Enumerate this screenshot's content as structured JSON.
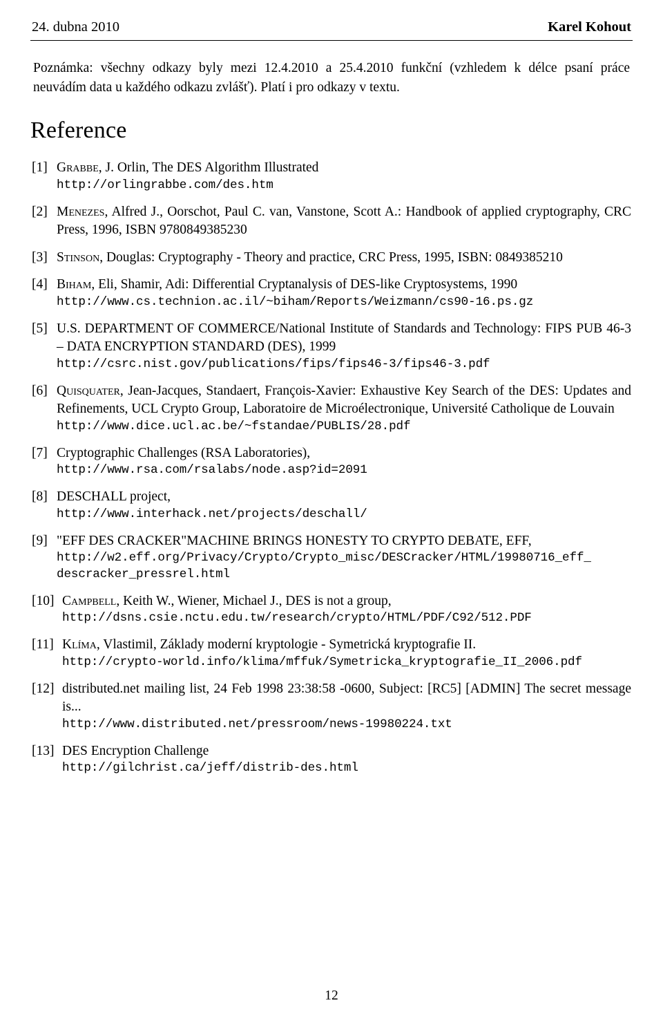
{
  "header": {
    "left": "24. dubna 2010",
    "right": "Karel Kohout"
  },
  "note": "Poznámka: všechny odkazy byly mezi 12.4.2010 a 25.4.2010 funkční (vzhledem k délce psaní práce neuvádím data u každého odkazu zvlášť). Platí i pro odkazy v textu.",
  "section_title": "Reference",
  "references": [
    {
      "label": "[1]",
      "author_sc": "Grabbe",
      "text": ", J. Orlin, The DES Algorithm Illustrated",
      "urls": [
        "http://orlingrabbe.com/des.htm"
      ]
    },
    {
      "label": "[2]",
      "author_sc": "Menezes",
      "text": ", Alfred J., Oorschot, Paul C. van, Vanstone, Scott A.: Handbook of applied cryptography, CRC Press, 1996, ISBN 9780849385230",
      "urls": []
    },
    {
      "label": "[3]",
      "author_sc": "Stinson",
      "text": ", Douglas: Cryptography - Theory and practice, CRC Press, 1995, ISBN: 0849385210",
      "urls": []
    },
    {
      "label": "[4]",
      "author_sc": "Biham",
      "text": ", Eli, Shamir, Adi: Differential Cryptanalysis of DES-like Cryptosystems, 1990",
      "urls": [
        "http://www.cs.technion.ac.il/~biham/Reports/Weizmann/cs90-16.ps.gz"
      ]
    },
    {
      "label": "[5]",
      "author_sc": "",
      "text": "U.S. DEPARTMENT OF COMMERCE/National Institute of Standards and Technology: FIPS PUB 46-3 – DATA ENCRYPTION STANDARD (DES), 1999",
      "urls": [
        "http://csrc.nist.gov/publications/fips/fips46-3/fips46-3.pdf"
      ]
    },
    {
      "label": "[6]",
      "author_sc": "Quisquater",
      "text": ", Jean-Jacques, Standaert, François-Xavier: Exhaustive Key Search of the DES: Updates and Refinements, UCL Crypto Group, Laboratoire de Microélectronique, Université Catholique de Louvain",
      "urls": [
        "http://www.dice.ucl.ac.be/~fstandae/PUBLIS/28.pdf"
      ]
    },
    {
      "label": "[7]",
      "author_sc": "",
      "text": "Cryptographic Challenges (RSA Laboratories),",
      "urls": [
        "http://www.rsa.com/rsalabs/node.asp?id=2091"
      ]
    },
    {
      "label": "[8]",
      "author_sc": "",
      "text": "DESCHALL project,",
      "urls": [
        "http://www.interhack.net/projects/deschall/"
      ]
    },
    {
      "label": "[9]",
      "author_sc": "",
      "text": "\"EFF DES CRACKER\"MACHINE BRINGS HONESTY TO CRYPTO DEBATE, EFF,",
      "urls": [
        "http://w2.eff.org/Privacy/Crypto/Crypto_misc/DESCracker/HTML/19980716_eff_",
        "descracker_pressrel.html"
      ]
    },
    {
      "label": "[10]",
      "author_sc": "Campbell",
      "text": ", Keith W., Wiener, Michael J., DES is not a group,",
      "urls": [
        "http://dsns.csie.nctu.edu.tw/research/crypto/HTML/PDF/C92/512.PDF"
      ]
    },
    {
      "label": "[11]",
      "author_sc": "Klíma",
      "text": ", Vlastimil, Základy moderní kryptologie - Symetrická kryptografie II.",
      "urls": [
        "http://crypto-world.info/klima/mffuk/Symetricka_kryptografie_II_2006.pdf"
      ]
    },
    {
      "label": "[12]",
      "author_sc": "",
      "text": "distributed.net mailing list, 24 Feb 1998 23:38:58 -0600, Subject: [RC5] [ADMIN] The secret message is...",
      "urls": [
        "http://www.distributed.net/pressroom/news-19980224.txt"
      ]
    },
    {
      "label": "[13]",
      "author_sc": "",
      "text": "DES Encryption Challenge",
      "urls": [
        "http://gilchrist.ca/jeff/distrib-des.html"
      ]
    }
  ],
  "page_number": "12"
}
